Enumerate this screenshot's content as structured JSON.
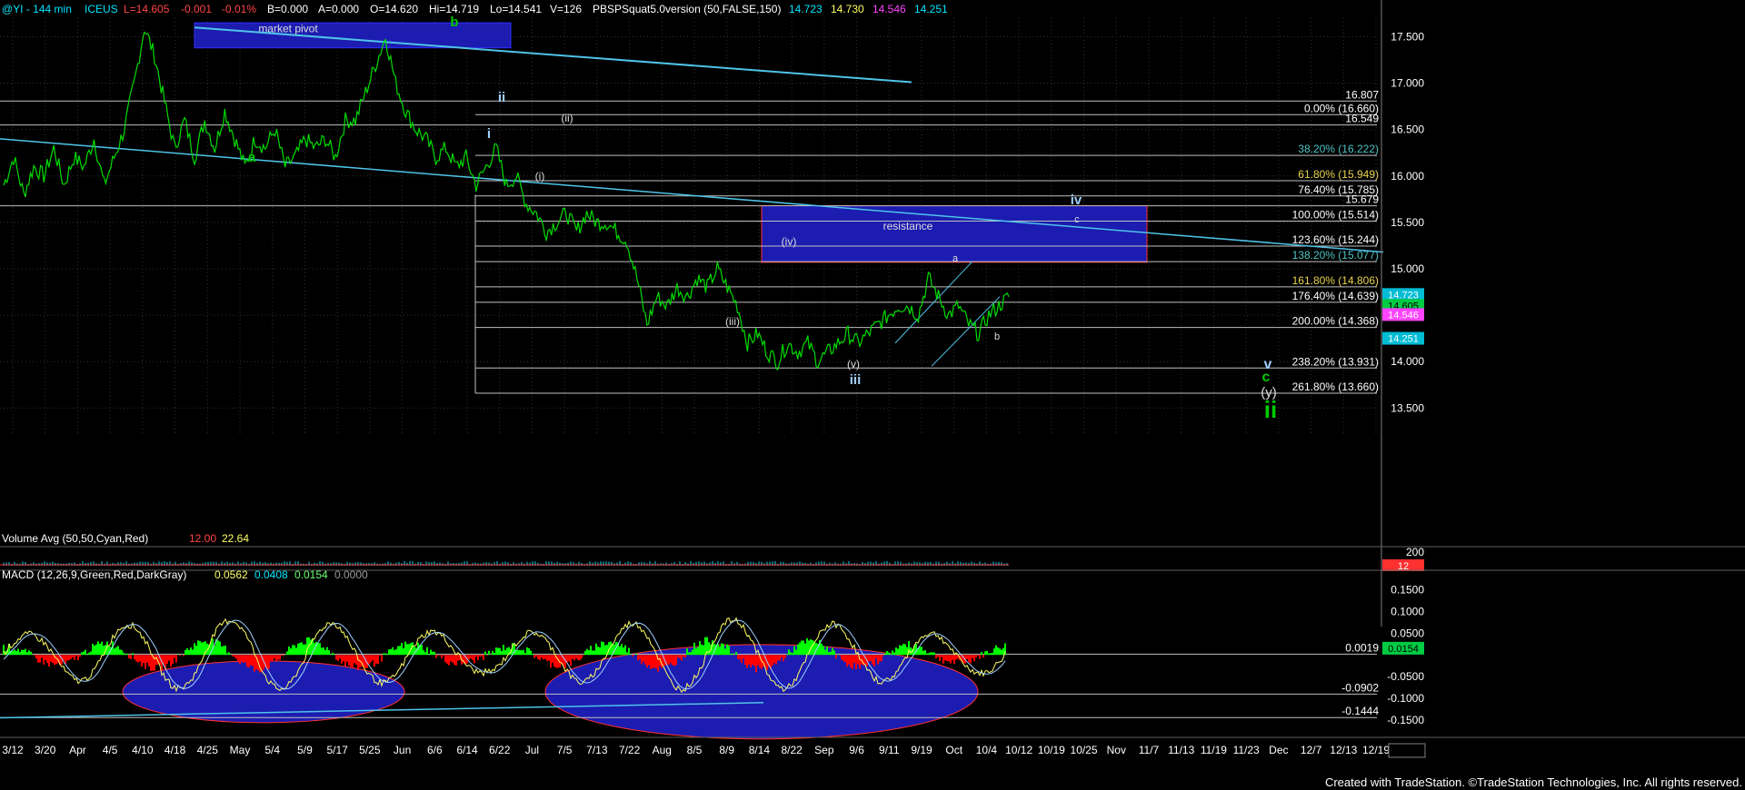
{
  "header": {
    "symbol": "@YI - 144 min",
    "exchange": "ICEUS",
    "last": "L=14.605",
    "change": "-0.001",
    "pct": "-0.01%",
    "b": "B=0.000",
    "a": "A=0.000",
    "open": "O=14.620",
    "hi": "Hi=14.719",
    "lo": "Lo=14.541",
    "vol": "V=126",
    "indicator": "PBSPSquat5.0version (50,FALSE,150)",
    "ind_values": [
      "14.723",
      "14.730",
      "14.546",
      "14.251"
    ],
    "ind_colors": [
      "#00e5ff",
      "#ffff66",
      "#ff44ff",
      "#00e5ff"
    ]
  },
  "volume_panel": {
    "label": "Volume Avg (50,50,Cyan,Red)",
    "values": [
      "12.00",
      "22.64"
    ],
    "value_colors": [
      "#ff4444",
      "#ffff66"
    ],
    "right_labels": [
      "200",
      "12"
    ]
  },
  "macd_panel": {
    "label": "MACD (12,26,9,Green,Red,DarkGray)",
    "values": [
      "0.0562",
      "0.0408",
      "0.0154",
      "0.0000"
    ],
    "value_colors": [
      "#ffff66",
      "#00e5ff",
      "#66ff66",
      "#999999"
    ],
    "ticks": [
      "0.1500",
      "0.1000",
      "0.0500",
      "-0.0500",
      "-0.1000",
      "-0.1500"
    ],
    "levels": [
      {
        "text": "0.0019",
        "color": "#ffffff"
      },
      {
        "text": "-0.0902",
        "color": "#ffffff"
      },
      {
        "text": "-0.1444",
        "color": "#ffffff"
      }
    ],
    "current": {
      "text": "0.0154",
      "bg": "#00cc44"
    }
  },
  "chart_data": {
    "type": "line",
    "series": [
      {
        "values": [
          15.9,
          16.2,
          15.8,
          16.1,
          16.0,
          16.3,
          15.9,
          16.2,
          16.1,
          16.4,
          15.9,
          16.2,
          16.5,
          17.0,
          17.6,
          17.3,
          16.8,
          16.3,
          16.6,
          16.2,
          16.6,
          16.3,
          16.7,
          16.4,
          16.1,
          16.4,
          16.3,
          16.5,
          16.1,
          16.2,
          16.4,
          16.3,
          16.4,
          16.2,
          16.6,
          16.6,
          16.9,
          17.2,
          17.5,
          17.0,
          16.7,
          16.5,
          16.4,
          16.2,
          16.3,
          16.1,
          16.2,
          15.9,
          16.1,
          16.3,
          15.9,
          16.0,
          15.7,
          15.6,
          15.4,
          15.5,
          15.6,
          15.4,
          15.6,
          15.5,
          15.5,
          15.4,
          15.3,
          14.9,
          14.4,
          14.7,
          14.6,
          14.8,
          14.7,
          14.9,
          14.8,
          15.0,
          14.8,
          14.6,
          14.2,
          14.3,
          14.1,
          14.0,
          14.2,
          14.1,
          14.2,
          14.0,
          14.1,
          14.2,
          14.3,
          14.2,
          14.3,
          14.4,
          14.5,
          14.6,
          14.6,
          14.5,
          14.9,
          14.7,
          14.5,
          14.6,
          14.4,
          14.3,
          14.5,
          14.6,
          14.7
        ]
      }
    ],
    "x_ticks": [
      "3/12",
      "3/20",
      "Apr",
      "4/5",
      "4/10",
      "4/18",
      "4/25",
      "May",
      "5/4",
      "5/9",
      "5/17",
      "5/25",
      "Jun",
      "6/6",
      "6/14",
      "6/22",
      "Jul",
      "7/5",
      "7/13",
      "7/22",
      "Aug",
      "8/5",
      "8/9",
      "8/14",
      "8/22",
      "Sep",
      "9/6",
      "9/11",
      "9/19",
      "Oct",
      "10/4",
      "10/12",
      "10/19",
      "10/25",
      "Nov",
      "11/7",
      "11/13",
      "11/19",
      "11/23",
      "Dec",
      "12/7",
      "12/13",
      "12/19"
    ],
    "y_ticks": [
      "17.500",
      "17.000",
      "16.500",
      "16.000",
      "15.500",
      "15.000",
      "14.500",
      "14.000",
      "13.500"
    ],
    "ylim": [
      13.2,
      17.7
    ],
    "fib_levels": [
      {
        "price": 16.807,
        "label": "16.807",
        "color": "#ffffff"
      },
      {
        "price": 16.66,
        "label": "0.00% (16.660)",
        "color": "#ffffff"
      },
      {
        "price": 16.549,
        "label": "16.549",
        "color": "#ffffff"
      },
      {
        "price": 16.222,
        "label": "38.20% (16.222)",
        "color": "#4fc3c3"
      },
      {
        "price": 15.949,
        "label": "61.80% (15.949)",
        "color": "#e8d44d"
      },
      {
        "price": 15.785,
        "label": "76.40% (15.785)",
        "color": "#ffffff"
      },
      {
        "price": 15.679,
        "label": "15.679",
        "color": "#ffffff"
      },
      {
        "price": 15.514,
        "label": "100.00% (15.514)",
        "color": "#ffffff"
      },
      {
        "price": 15.244,
        "label": "123.60% (15.244)",
        "color": "#ffffff"
      },
      {
        "price": 15.077,
        "label": "138.20% (15.077)",
        "color": "#4fc3c3"
      },
      {
        "price": 14.806,
        "label": "161.80% (14.806)",
        "color": "#e8d44d"
      },
      {
        "price": 14.639,
        "label": "176.40% (14.639)",
        "color": "#ffffff"
      },
      {
        "price": 14.368,
        "label": "200.00% (14.368)",
        "color": "#ffffff"
      },
      {
        "price": 13.931,
        "label": "238.20% (13.931)",
        "color": "#ffffff"
      },
      {
        "price": 13.66,
        "label": "261.80% (13.660)",
        "color": "#ffffff"
      }
    ],
    "price_tags": [
      {
        "text": "14.723",
        "bg": "#00bcd4",
        "color": "#ffffff"
      },
      {
        "text": "14.605",
        "bg": "#00cc44",
        "color": "#000000"
      },
      {
        "text": "14.546",
        "bg": "#ff44ff",
        "color": "#ffffff"
      },
      {
        "text": "14.251",
        "bg": "#00bcd4",
        "color": "#ffffff"
      }
    ],
    "boxes": [
      {
        "label": "market pivot"
      },
      {
        "label": "resistance"
      }
    ],
    "annotations": [
      {
        "text": "a",
        "color": "#00cc00",
        "bold": true
      },
      {
        "text": "b",
        "color": "#00cc00",
        "bold": true
      },
      {
        "text": "ii",
        "color": "#9fd0ff",
        "bold": true
      },
      {
        "text": "i",
        "color": "#9fd0ff",
        "bold": true
      },
      {
        "text": "(ii)",
        "color": "#dddddd",
        "bold": false
      },
      {
        "text": "(i)",
        "color": "#dddddd",
        "bold": false
      },
      {
        "text": "(iv)",
        "color": "#dddddd",
        "bold": false
      },
      {
        "text": "iv",
        "color": "#9fd0ff",
        "bold": true
      },
      {
        "text": "c",
        "color": "#dddddd",
        "bold": false
      },
      {
        "text": "(iii)",
        "color": "#dddddd",
        "bold": false
      },
      {
        "text": "a",
        "color": "#dddddd",
        "bold": false
      },
      {
        "text": "b",
        "color": "#dddddd",
        "bold": false
      },
      {
        "text": "(v)",
        "color": "#dddddd",
        "bold": false
      },
      {
        "text": "iii",
        "color": "#9fd0ff",
        "bold": true
      },
      {
        "text": "v",
        "color": "#9fd0ff",
        "bold": true
      },
      {
        "text": "c",
        "color": "#00cc00",
        "bold": true
      },
      {
        "text": "(y)",
        "color": "#dddddd",
        "bold": false
      },
      {
        "text": "ii",
        "color": "#00cc00",
        "bold": true
      }
    ],
    "grid": true
  },
  "footer": {
    "copyright": "Created with TradeStation. ©TradeStation Technologies, Inc. All rights reserved."
  },
  "colors": {
    "background": "#000000",
    "price": "#00dd00",
    "trendline": "#4fc3e8",
    "box": "#1c1cb0",
    "macd_hist_pos": "#00ff00",
    "macd_hist_neg": "#ff0000"
  }
}
